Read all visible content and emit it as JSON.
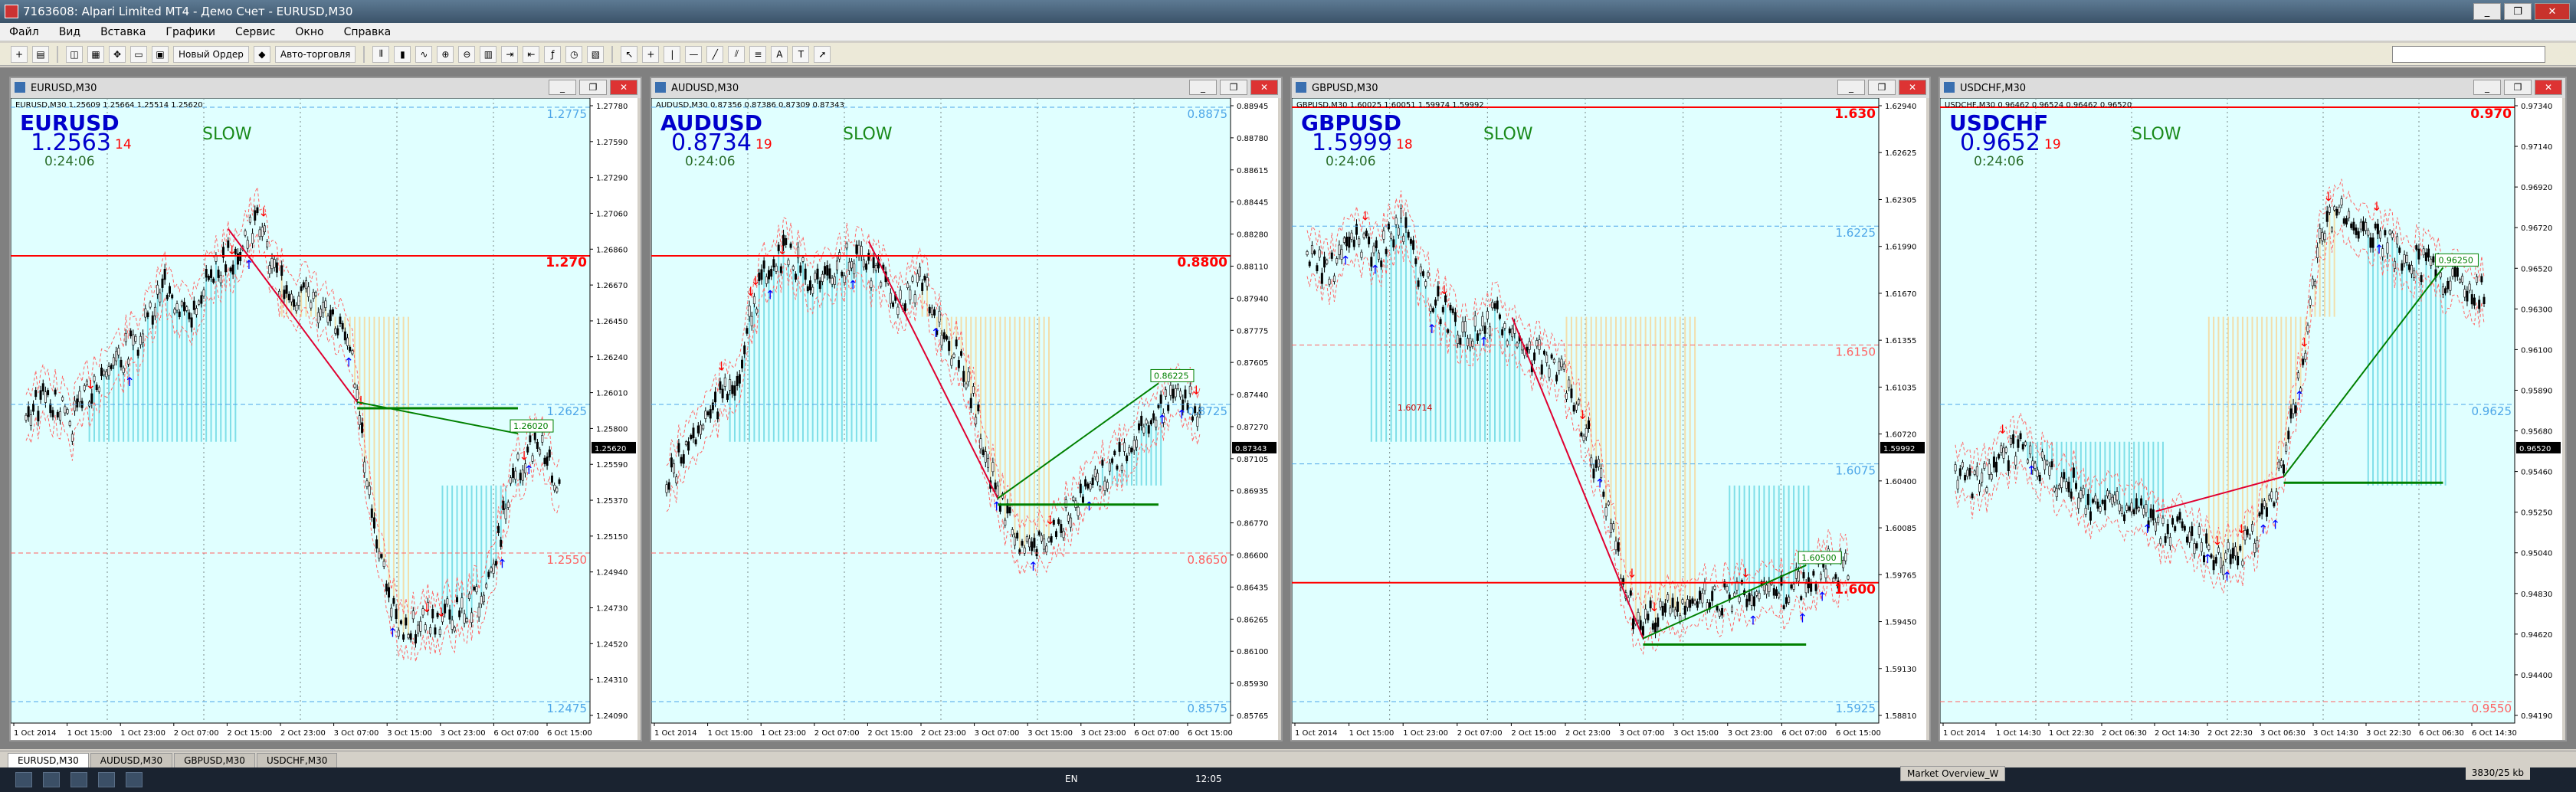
{
  "window": {
    "title": "7163608: Alpari Limited MT4 - Демо Счет - EURUSD,M30"
  },
  "menu": [
    "Файл",
    "Вид",
    "Вставка",
    "Графики",
    "Сервис",
    "Окно",
    "Справка"
  ],
  "toolbar": {
    "new_order": "Новый Ордер",
    "autotrading": "Авто-торговля"
  },
  "charts": [
    {
      "symbol": "EURUSD",
      "window_title": "EURUSD,M30",
      "info_line": "EURUSD,M30 1.25609 1.25664 1.25514 1.25620",
      "price": "1.2563",
      "spread": "14",
      "timer": "0:24:06",
      "mode": "SLOW",
      "axis_labels": [
        "1.27780",
        "1.27590",
        "1.27290",
        "1.27060",
        "1.26860",
        "1.26670",
        "1.26450",
        "1.26240",
        "1.26010",
        "1.25800",
        "1.25590",
        "1.25370",
        "1.25150",
        "1.24940",
        "1.24730",
        "1.24520",
        "1.24310",
        "1.24090"
      ],
      "time_labels": [
        "1 Oct 2014",
        "1 Oct 15:00",
        "1 Oct 23:00",
        "2 Oct 07:00",
        "2 Oct 15:00",
        "2 Oct 23:00",
        "3 Oct 07:00",
        "3 Oct 15:00",
        "3 Oct 23:00",
        "6 Oct 07:00",
        "6 Oct 15:00"
      ],
      "levels": [
        {
          "text": "1.2775",
          "c": "#4da6e8"
        },
        {
          "text": "1.270",
          "c": "#ff0000"
        },
        {
          "text": "1.2625",
          "c": "#4da6e8"
        },
        {
          "text": "1.2550",
          "c": "#ff6060"
        },
        {
          "text": "1.2475",
          "c": "#4da6e8"
        }
      ],
      "tag": "1.26020",
      "cur_price": "1.25620"
    },
    {
      "symbol": "AUDUSD",
      "window_title": "AUDUSD,M30",
      "info_line": "AUDUSD,M30 0.87356 0.87386 0.87309 0.87343",
      "price": "0.8734",
      "spread": "19",
      "timer": "0:24:06",
      "mode": "SLOW",
      "axis_labels": [
        "0.88945",
        "0.88780",
        "0.88615",
        "0.88445",
        "0.88280",
        "0.88110",
        "0.87940",
        "0.87775",
        "0.87605",
        "0.87440",
        "0.87270",
        "0.87105",
        "0.86935",
        "0.86770",
        "0.86600",
        "0.86435",
        "0.86265",
        "0.86100",
        "0.85930",
        "0.85765"
      ],
      "time_labels": [
        "1 Oct 2014",
        "1 Oct 15:00",
        "1 Oct 23:00",
        "2 Oct 07:00",
        "2 Oct 15:00",
        "2 Oct 23:00",
        "3 Oct 07:00",
        "3 Oct 15:00",
        "3 Oct 23:00",
        "6 Oct 07:00",
        "6 Oct 15:00"
      ],
      "levels": [
        {
          "text": "0.8875",
          "c": "#4da6e8"
        },
        {
          "text": "0.8800",
          "c": "#ff0000"
        },
        {
          "text": "0.8725",
          "c": "#4da6e8"
        },
        {
          "text": "0.8650",
          "c": "#ff6060"
        },
        {
          "text": "0.8575",
          "c": "#4da6e8"
        }
      ],
      "tag": "0.86225",
      "cur_price": "0.87343"
    },
    {
      "symbol": "GBPUSD",
      "window_title": "GBPUSD,M30",
      "info_line": "GBPUSD,M30 1.60025 1.60051 1.59974 1.59992",
      "price": "1.5999",
      "spread": "18",
      "timer": "0:24:06",
      "mode": "SLOW",
      "axis_labels": [
        "1.62940",
        "1.62625",
        "1.62305",
        "1.61990",
        "1.61670",
        "1.61355",
        "1.61035",
        "1.60720",
        "1.60400",
        "1.60085",
        "1.59765",
        "1.59450",
        "1.59130",
        "1.58810"
      ],
      "time_labels": [
        "1 Oct 2014",
        "1 Oct 15:00",
        "1 Oct 23:00",
        "2 Oct 07:00",
        "2 Oct 15:00",
        "2 Oct 23:00",
        "3 Oct 07:00",
        "3 Oct 15:00",
        "3 Oct 23:00",
        "6 Oct 07:00",
        "6 Oct 15:00"
      ],
      "levels": [
        {
          "text": "1.630",
          "c": "#ff0000"
        },
        {
          "text": "1.6225",
          "c": "#4da6e8"
        },
        {
          "text": "1.6150",
          "c": "#ff6060"
        },
        {
          "text": "1.6075",
          "c": "#4da6e8"
        },
        {
          "text": "1.600",
          "c": "#ff0000"
        },
        {
          "text": "1.5925",
          "c": "#4da6e8"
        }
      ],
      "tag": "1.60500",
      "tag2": "1.60714",
      "cur_price": "1.59992"
    },
    {
      "symbol": "USDCHF",
      "window_title": "USDCHF,M30",
      "info_line": "USDCHF,M30 0.96462 0.96524 0.96462 0.96520",
      "price": "0.9652",
      "spread": "19",
      "timer": "0:24:06",
      "mode": "SLOW",
      "axis_labels": [
        "0.97340",
        "0.97140",
        "0.96920",
        "0.96720",
        "0.96520",
        "0.96300",
        "0.96100",
        "0.95890",
        "0.95680",
        "0.95460",
        "0.95250",
        "0.95040",
        "0.94830",
        "0.94620",
        "0.94400",
        "0.94190"
      ],
      "time_labels": [
        "1 Oct 2014",
        "1 Oct 14:30",
        "1 Oct 22:30",
        "2 Oct 06:30",
        "2 Oct 14:30",
        "2 Oct 22:30",
        "3 Oct 06:30",
        "3 Oct 14:30",
        "3 Oct 22:30",
        "6 Oct 06:30",
        "6 Oct 14:30"
      ],
      "levels": [
        {
          "text": "0.970",
          "c": "#ff0000"
        },
        {
          "text": "0.9625",
          "c": "#4da6e8"
        },
        {
          "text": "0.9550",
          "c": "#ff6060"
        }
      ],
      "tag": "0.96250",
      "cur_price": "0.96520"
    }
  ],
  "tabs": [
    "EURUSD,M30",
    "AUDUSD,M30",
    "GBPUSD,M30",
    "USDCHF,M30"
  ],
  "status": {
    "market_overview": "Market Overview_W",
    "traffic": "3830/25 kb",
    "lang": "EN",
    "clock": "12:05"
  },
  "colors": {
    "chart_bg": "#e0ffff",
    "accent_blue": "#0000cc",
    "red": "#ff0000",
    "green": "#008000",
    "aqua_fill": "#7fdfe8",
    "wheat_fill": "#f2deab"
  }
}
